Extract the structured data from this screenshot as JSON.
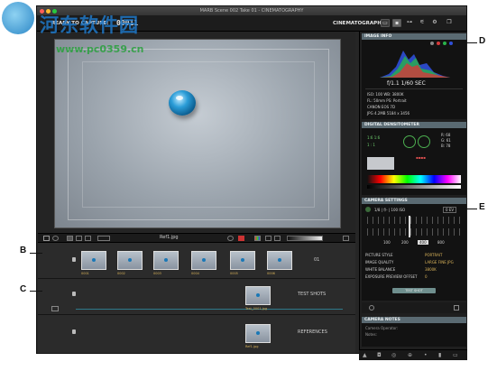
{
  "window": {
    "title": "MARB  Scene 002  Take 01 - CINEMATOGRAPHY"
  },
  "toolbar": {
    "status": "READY TO CAPTURE:",
    "counter": "00011",
    "mode": "CINEMATOGRAPHY"
  },
  "filmstrip_bar": {
    "filename": "Ref1.jpg"
  },
  "rows": [
    {
      "title": "01",
      "thumbs": [
        "0001",
        "0002",
        "0003",
        "0004",
        "0005",
        "0006"
      ]
    },
    {
      "title": "TEST SHOTS",
      "thumbs": [
        "Test_0001.jpg"
      ]
    },
    {
      "title": "REFERENCES",
      "thumbs": [
        "Ref1.jpg"
      ]
    }
  ],
  "panel": {
    "image_info": {
      "header": "IMAGE INFO",
      "exposure": "f/1.1   1/60 SEC",
      "lines": [
        "ISO: 100   WB: 3800K",
        "FL: 50mm   PS: Portrait",
        "CANON EOS 7D",
        "JPG  4.2MB  5184 x 3456"
      ]
    },
    "densitometer": {
      "header": "DIGITAL DENSITOMETER",
      "values": [
        "1:6  1:6",
        "1 : 1",
        "R: 68",
        "G: 61",
        "B: 78"
      ]
    },
    "camera_settings": {
      "header": "CAMERA SETTINGS",
      "shutter": "1/8 | f/- | 100 ISO",
      "ev": "0 EV",
      "iso_options": [
        "100",
        "200",
        "400",
        "800"
      ],
      "settings": [
        {
          "label": "PICTURE STYLE",
          "value": "PORTRAIT"
        },
        {
          "label": "IMAGE QUALITY",
          "value": "LARGE FINE JPG"
        },
        {
          "label": "WHITE BALANCE",
          "value": "3800K"
        },
        {
          "label": "EXPOSURE PREVIEW OFFSET",
          "value": "0"
        }
      ],
      "test_button": "TEST SHOT"
    },
    "camera_notes": {
      "header": "CAMERA NOTES",
      "lines": [
        "Camera Operator:",
        "Notes:"
      ]
    }
  },
  "callouts": {
    "b": "B",
    "c": "C",
    "d": "D",
    "e": "E"
  },
  "watermark": {
    "cn": "河东软件园",
    "url": "www.pc0359.cn"
  },
  "colors": {
    "panel_header": "#5a6a72",
    "accent_blue": "#2b9dd8",
    "label_gold": "#d9b35a"
  }
}
